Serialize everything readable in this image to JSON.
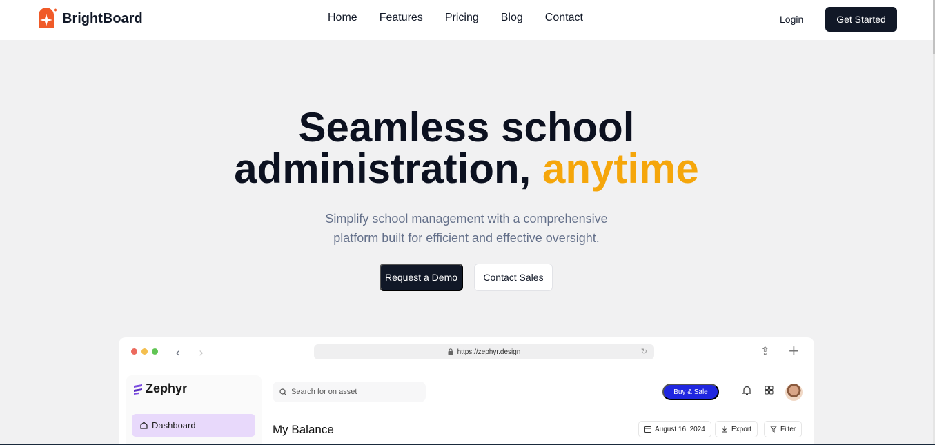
{
  "brand": {
    "name": "BrightBoard",
    "logo_icon": "spark-logo-icon",
    "accent": "#f05a28"
  },
  "nav": {
    "links": [
      "Home",
      "Features",
      "Pricing",
      "Blog",
      "Contact"
    ],
    "login_label": "Login",
    "cta_label": "Get Started"
  },
  "hero": {
    "title_line1": "Seamless school",
    "title_line2": "administration,",
    "title_accent": "anytime",
    "accent_color": "#f5a60b",
    "subtitle": "Simplify school management with a comprehensive platform built for efficient and effective oversight.",
    "primary_button": "Request a Demo",
    "secondary_button": "Contact Sales"
  },
  "mockup": {
    "url": "https://zephyr.design",
    "app_name": "Zephyr",
    "sidebar_item": "Dashboard",
    "search_placeholder": "Search for on asset",
    "buy_button": "Buy & Sale",
    "page_title": "My Balance",
    "date_chip": "August 16, 2024",
    "export_chip": "Export",
    "filter_chip": "Filter"
  }
}
